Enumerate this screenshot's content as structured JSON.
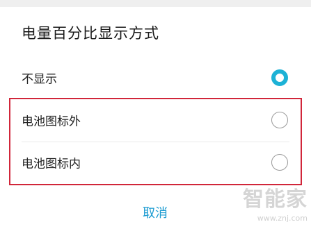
{
  "dialog": {
    "title": "电量百分比显示方式",
    "options": [
      {
        "label": "不显示",
        "selected": true
      },
      {
        "label": "电池图标外",
        "selected": false
      },
      {
        "label": "电池图标内",
        "selected": false
      }
    ],
    "cancel_label": "取消"
  },
  "colors": {
    "accent": "#1db2d6",
    "highlight_border": "#d1263a",
    "cancel_text": "#1b9bd1"
  },
  "watermark": {
    "logo": "智能家",
    "url": "www.znj.com"
  }
}
